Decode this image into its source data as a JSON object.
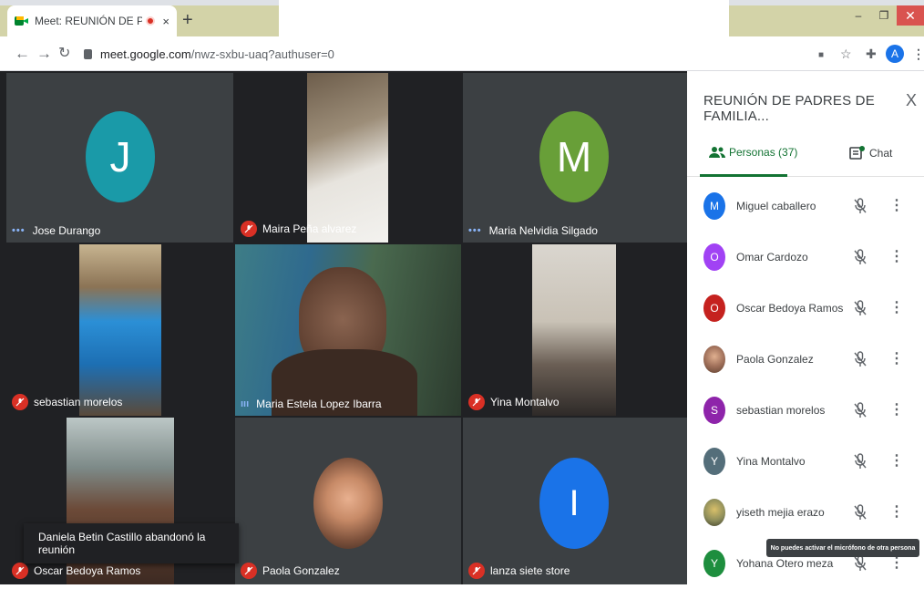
{
  "browser": {
    "tab_title": "Meet: REUNIÓN DE PADRES",
    "tab_close": "×",
    "new_tab": "+",
    "url_host": "meet.google.com",
    "url_path": "/nwz-sxbu-uaq?authuser=0",
    "profile_initial": "A",
    "win_minimize": "–",
    "win_restore": "❐",
    "win_close": "✕"
  },
  "tiles": [
    {
      "name": "Jose Durango",
      "status": "dots",
      "letter": "J",
      "color": "#1a9aa8"
    },
    {
      "name": "Maira Peña alvarez",
      "status": "muted"
    },
    {
      "name": "Maria Nelvidia Silgado",
      "status": "dots",
      "letter": "M",
      "color": "#689f38"
    },
    {
      "name": "sebastian morelos",
      "status": "muted"
    },
    {
      "name": "Maria Estela Lopez Ibarra",
      "status": "speaking"
    },
    {
      "name": "Yina Montalvo",
      "status": "muted"
    },
    {
      "name": "Oscar Bedoya Ramos",
      "status": "muted"
    },
    {
      "name": "Paola Gonzalez",
      "status": "muted"
    },
    {
      "name": "lanza siete store",
      "status": "muted",
      "letter": "I",
      "color": "#1a73e8"
    }
  ],
  "toast": "Daniela Betin Castillo abandonó la reunión",
  "panel": {
    "title": "REUNIÓN DE PADRES DE FAMILIA...",
    "close": "X",
    "tab_people": "Personas (37)",
    "tab_chat": "Chat",
    "participants": [
      {
        "name": "Miguel caballero",
        "initial": "M",
        "color": "#1a73e8"
      },
      {
        "name": "Omar Cardozo",
        "initial": "O",
        "color": "#a142f4"
      },
      {
        "name": "Oscar Bedoya Ramos",
        "initial": "O",
        "color": "#c5221f"
      },
      {
        "name": "Paola Gonzalez",
        "initial": "",
        "color": "#b08968"
      },
      {
        "name": "sebastian morelos",
        "initial": "S",
        "color": "#8e24aa"
      },
      {
        "name": "Yina Montalvo",
        "initial": "Y",
        "color": "#546e7a"
      },
      {
        "name": "yiseth mejia erazo",
        "initial": "",
        "color": "#8d8d5a"
      },
      {
        "name": "Yohana Otero meza",
        "initial": "Y",
        "color": "#1e8e3e"
      }
    ],
    "more": "⋮"
  },
  "tooltip": "No puedes activar el micrófono de otra persona"
}
